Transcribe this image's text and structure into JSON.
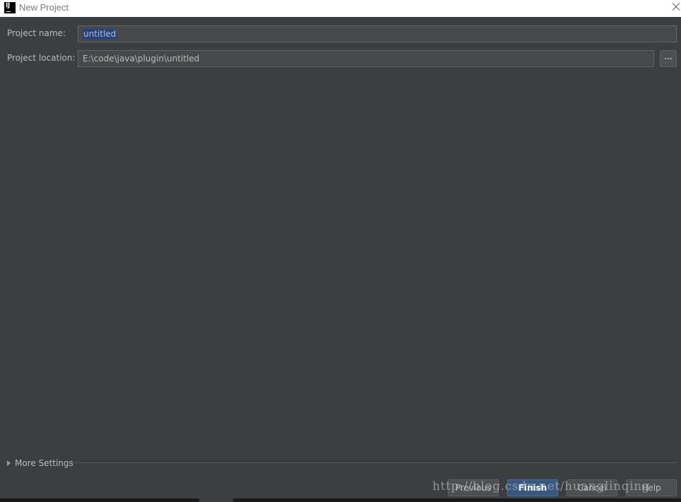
{
  "window": {
    "title": "New Project",
    "app_icon": "IJ"
  },
  "form": {
    "project_name_label": "Project name:",
    "project_name_value": "untitled",
    "project_location_label": "Project location:",
    "project_location_value": "E:\\code\\java\\plugin\\untitled",
    "browse_label": "..."
  },
  "more_settings": {
    "label": "More Settings",
    "icon": "chevron-right-icon"
  },
  "buttons": {
    "previous": "Previous",
    "finish": "Finish",
    "cancel": "Cancel",
    "help": "Help"
  },
  "watermark": "http://blog.csdn.net/huanglinqing",
  "colors": {
    "background": "#3c3f41",
    "field_bg": "#45494a",
    "selection": "#214283",
    "primary_button": "#365880",
    "text": "#bbbbbb"
  }
}
